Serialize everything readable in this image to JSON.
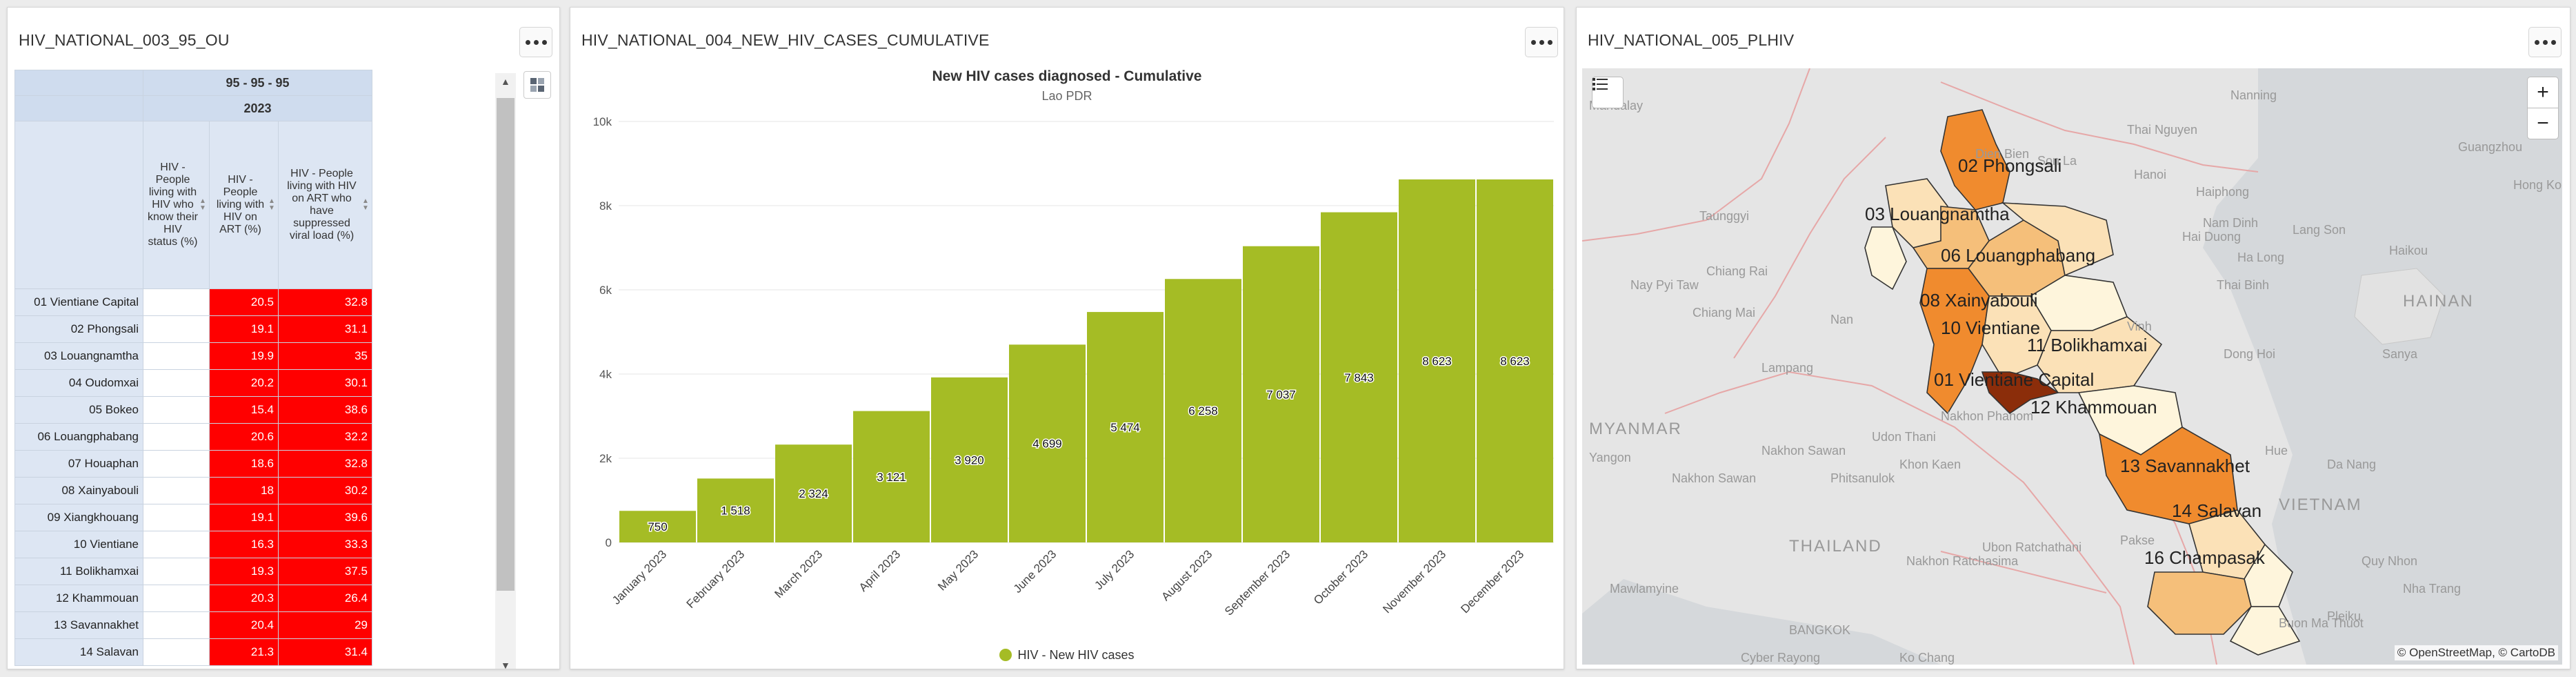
{
  "panels": {
    "table": {
      "title": "HIV_NATIONAL_003_95_OU",
      "header_group": "95 - 95 - 95",
      "header_year": "2023",
      "columns": [
        "HIV - People living with HIV who know their HIV status (%)",
        "HIV - People living with HIV on ART (%)",
        "HIV - People living with HIV on ART who have suppressed viral load (%)"
      ],
      "rows": [
        {
          "label": "01 Vientiane Capital",
          "c1": "",
          "c2": "20.5",
          "c3": "32.8"
        },
        {
          "label": "02 Phongsali",
          "c1": "",
          "c2": "19.1",
          "c3": "31.1"
        },
        {
          "label": "03 Louangnamtha",
          "c1": "",
          "c2": "19.9",
          "c3": "35"
        },
        {
          "label": "04 Oudomxai",
          "c1": "",
          "c2": "20.2",
          "c3": "30.1"
        },
        {
          "label": "05 Bokeo",
          "c1": "",
          "c2": "15.4",
          "c3": "38.6"
        },
        {
          "label": "06 Louangphabang",
          "c1": "",
          "c2": "20.6",
          "c3": "32.2"
        },
        {
          "label": "07 Houaphan",
          "c1": "",
          "c2": "18.6",
          "c3": "32.8"
        },
        {
          "label": "08 Xainyabouli",
          "c1": "",
          "c2": "18",
          "c3": "30.2"
        },
        {
          "label": "09 Xiangkhouang",
          "c1": "",
          "c2": "19.1",
          "c3": "39.6"
        },
        {
          "label": "10 Vientiane",
          "c1": "",
          "c2": "16.3",
          "c3": "33.3"
        },
        {
          "label": "11 Bolikhamxai",
          "c1": "",
          "c2": "19.3",
          "c3": "37.5"
        },
        {
          "label": "12 Khammouan",
          "c1": "",
          "c2": "20.3",
          "c3": "26.4"
        },
        {
          "label": "13 Savannakhet",
          "c1": "",
          "c2": "20.4",
          "c3": "29"
        },
        {
          "label": "14 Salavan",
          "c1": "",
          "c2": "21.3",
          "c3": "31.4"
        }
      ]
    },
    "chart": {
      "title": "HIV_NATIONAL_004_NEW_HIV_CASES_CUMULATIVE"
    },
    "map": {
      "title": "HIV_NATIONAL_005_PLHIV",
      "zoom_in": "+",
      "zoom_out": "−",
      "attribution": "© OpenStreetMap, © CartoDB",
      "base_labels": [
        "Nanning",
        "Guangzhou",
        "Hong Kong",
        "Haikou",
        "HAINAN",
        "Sanya",
        "Hanoi",
        "Thai Nguyen",
        "Haiphong",
        "Nam Dinh",
        "Vinh",
        "Hue",
        "Da Nang",
        "Quy Nhon",
        "Pleiku",
        "Buon Ma Thuot",
        "Nha Trang",
        "Hai Duong",
        "Dong Hoi",
        "MYANMAR",
        "Yangon",
        "Nay Pyi Taw",
        "Mandalay",
        "Taunggyi",
        "Lampang",
        "Chiang Rai",
        "Nan",
        "Khon Kaen",
        "Udon Thani",
        "Nakhon Phanom",
        "Nakhon Ratchasima",
        "Ubon Ratchathani",
        "Nakhon Sawan",
        "Phitsanulok",
        "THAILAND",
        "BANGKOK",
        "Mawlamyine",
        "Cyber Rayong",
        "Pakse",
        "Ko Chang",
        "Ha Long",
        "Lang Son",
        "Son La",
        "Dien Bien",
        "Thai Binh",
        "Nakhon Sawan",
        "Chiang Mai",
        "VIETNAM"
      ],
      "province_labels": [
        "02 Phongsali",
        "03 Louangnamtha",
        "06 Louangphabang",
        "08 Xainyabouli",
        "10 Vientiane",
        "11 Bolikhamxai",
        "01 Vientiane Capital",
        "12 Khammouan",
        "13 Savannakhet",
        "14 Salavan",
        "16 Champasak"
      ],
      "colors": {
        "darkest": "#8b2d0a",
        "dark": "#f08b2e",
        "mid": "#f5bf7a",
        "light": "#fbe1b7",
        "lightest": "#fef5dc"
      }
    }
  },
  "chart_data": {
    "type": "bar",
    "title": "New HIV cases diagnosed - Cumulative",
    "subtitle": "Lao PDR",
    "categories": [
      "January 2023",
      "February 2023",
      "March 2023",
      "April 2023",
      "May 2023",
      "June 2023",
      "July 2023",
      "August 2023",
      "September 2023",
      "October 2023",
      "November 2023",
      "December 2023"
    ],
    "series": [
      {
        "name": "HIV - New HIV cases",
        "values": [
          750,
          1518,
          2324,
          3121,
          3920,
          4699,
          5474,
          6258,
          7037,
          7843,
          8623,
          8623
        ],
        "labels": [
          "750",
          "1 518",
          "2 324",
          "3 121",
          "3 920",
          "4 699",
          "5 474",
          "6 258",
          "7 037",
          "7 843",
          "8 623",
          "8 623"
        ]
      }
    ],
    "ylim": [
      0,
      10000
    ],
    "yticks": [
      "0",
      "2k",
      "4k",
      "6k",
      "8k",
      "10k"
    ],
    "color": "#a5bc25",
    "legend": "bottom",
    "grid": true
  }
}
